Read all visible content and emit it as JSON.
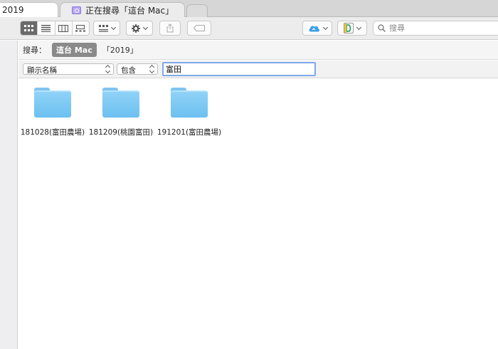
{
  "tabs": [
    {
      "label": "2019",
      "active": false
    },
    {
      "label": "正在搜尋「這台 Mac」",
      "active": true
    }
  ],
  "toolbar": {
    "view_modes": [
      "icon-view",
      "list-view",
      "column-view",
      "gallery-view"
    ],
    "selected_view": "icon-view",
    "search_placeholder": "搜尋"
  },
  "scope": {
    "label": "搜尋：",
    "selected": "這台 Mac",
    "other": "「2019」"
  },
  "criteria": {
    "attribute": "顯示名稱",
    "operator": "包含",
    "value": "富田"
  },
  "items": [
    {
      "name": "181028(富田農場)",
      "icon": "folder-icon"
    },
    {
      "name": "181209(桃園富田)",
      "icon": "folder-icon"
    },
    {
      "name": "191201(富田農場)",
      "icon": "folder-icon"
    }
  ],
  "colors": {
    "folder": "#7cc8f2",
    "focus_ring": "#7fa9e8",
    "selected_view": "#6a6a6a"
  }
}
